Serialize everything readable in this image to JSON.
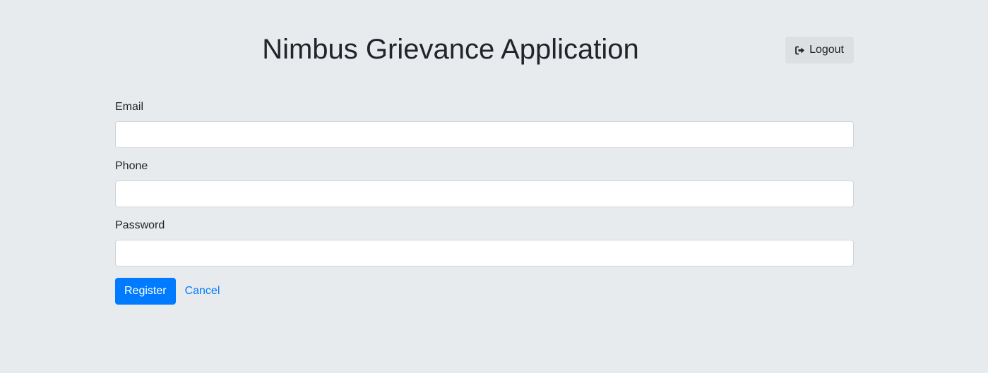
{
  "header": {
    "title": "Nimbus Grievance Application",
    "logout_label": "Logout",
    "logout_icon": "sign-out-icon"
  },
  "form": {
    "fields": [
      {
        "label": "Email",
        "value": "",
        "placeholder": ""
      },
      {
        "label": "Phone",
        "value": "",
        "placeholder": ""
      },
      {
        "label": "Password",
        "value": "",
        "placeholder": ""
      }
    ],
    "register_label": "Register",
    "cancel_label": "Cancel"
  },
  "colors": {
    "background": "#e8ebee",
    "primary": "#007bff",
    "logout_bg": "#dde0e3",
    "text": "#212529"
  }
}
